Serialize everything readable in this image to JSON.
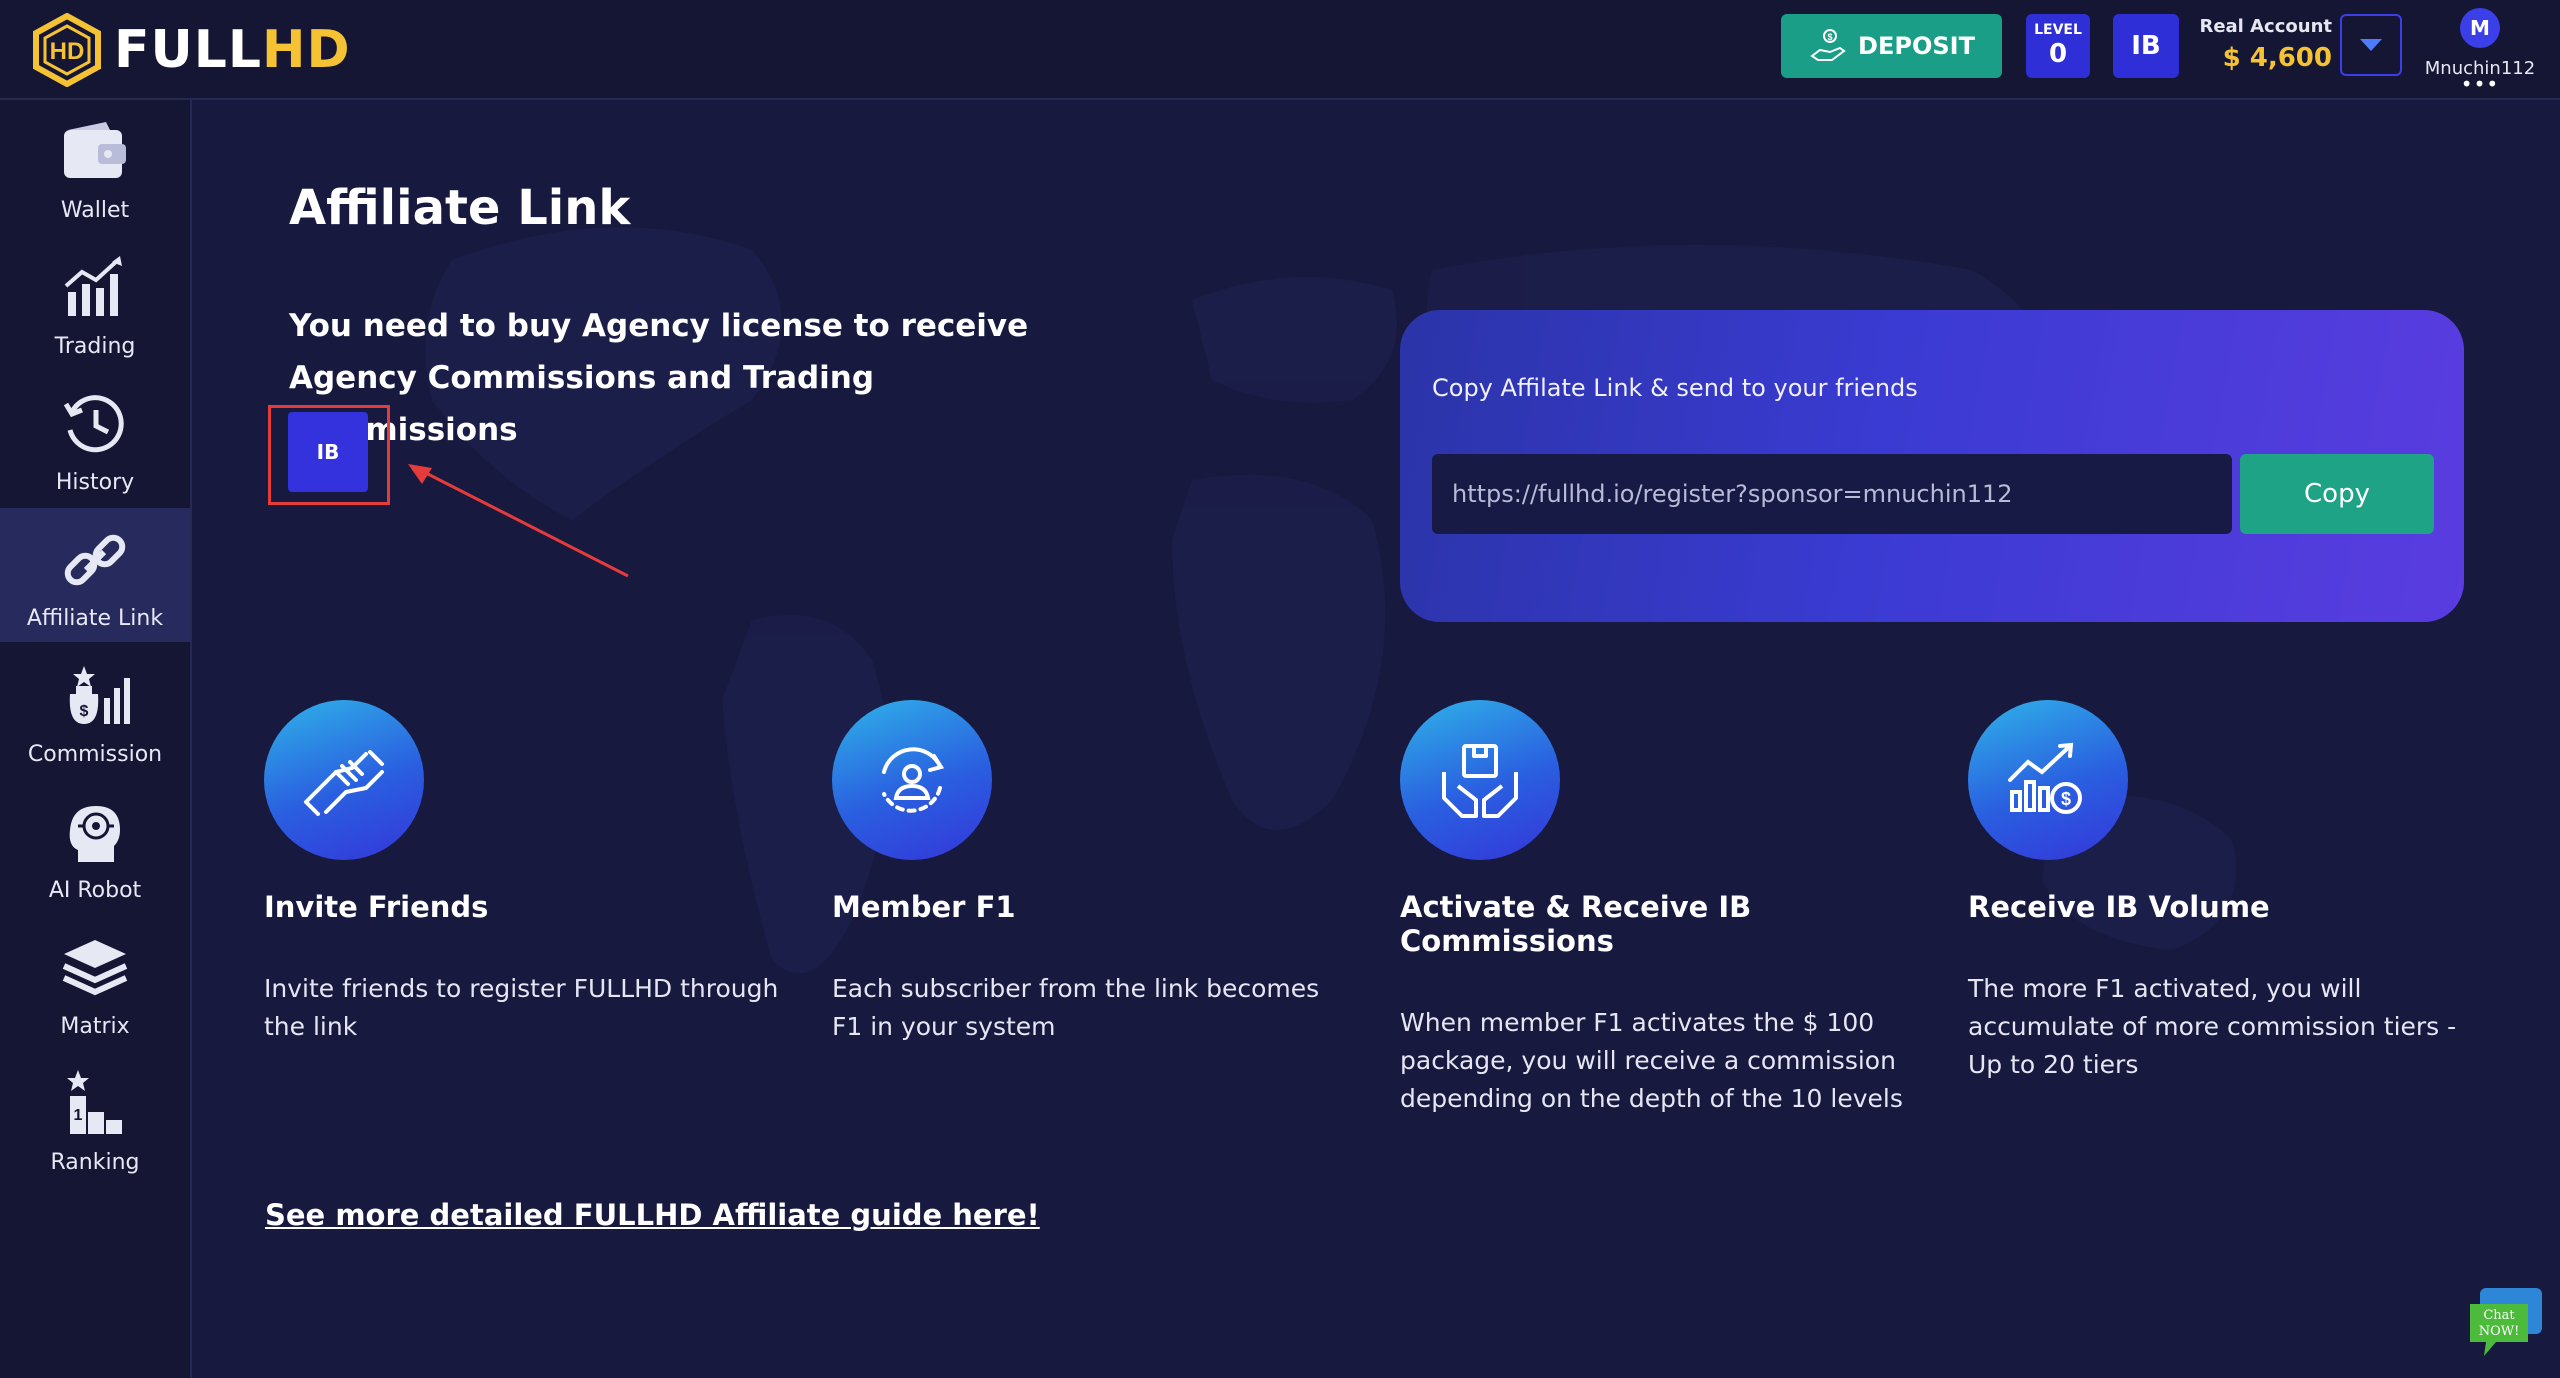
{
  "brand": {
    "name_white": "FULL",
    "name_yellow": "HD"
  },
  "header": {
    "deposit_label": "DEPOSIT",
    "level_label": "LEVEL",
    "level_value": "0",
    "ib_label": "IB",
    "account_label": "Real Account",
    "account_balance": "$ 4,600",
    "user_initial": "M",
    "username": "Mnuchin112",
    "more": "•••"
  },
  "sidebar": {
    "items": [
      {
        "label": "Wallet",
        "icon": "wallet-icon"
      },
      {
        "label": "Trading",
        "icon": "trading-chart-icon"
      },
      {
        "label": "History",
        "icon": "history-icon"
      },
      {
        "label": "Affiliate Link",
        "icon": "link-icon",
        "active": true
      },
      {
        "label": "Commission",
        "icon": "commission-icon"
      },
      {
        "label": "AI Robot",
        "icon": "ai-robot-icon"
      },
      {
        "label": "Matrix",
        "icon": "matrix-icon"
      },
      {
        "label": "Ranking",
        "icon": "ranking-icon"
      }
    ]
  },
  "main": {
    "title": "Affiliate Link",
    "notice_line1": "You need to buy Agency license to receive",
    "notice_line2": "Agency Commissions and Trading Commissions",
    "ib_button": "IB",
    "link_card": {
      "caption": "Copy Affilate Link & send to your friends",
      "url": "https://fullhd.io/register?sponsor=mnuchin112",
      "copy_label": "Copy"
    },
    "features": [
      {
        "title": "Invite Friends",
        "desc": "Invite friends to register FULLHD through the link",
        "icon": "handshake-icon"
      },
      {
        "title": "Member F1",
        "desc": "Each subscriber from the link becomes F1 in your system",
        "icon": "member-refresh-icon"
      },
      {
        "title": "Activate & Receive IB Commissions",
        "desc": "When member F1 activates the $ 100 package, you will receive a commission depending on the depth of the 10 levels",
        "icon": "package-hands-icon"
      },
      {
        "title": "Receive IB Volume",
        "desc": "The more F1 activated, you will accumulate of more commission tiers - Up to 20 tiers",
        "icon": "growth-chart-icon"
      }
    ],
    "guide_link": "See more detailed FULLHD Affiliate guide here!"
  },
  "chat_widget": {
    "line1": "Chat",
    "line2": "NOW!"
  },
  "colors": {
    "background": "#17193f",
    "accent_green": "#1b9e87",
    "accent_blue": "#2f2fd8",
    "balance_yellow": "#f4c232",
    "highlight_red": "#e53b3b"
  }
}
